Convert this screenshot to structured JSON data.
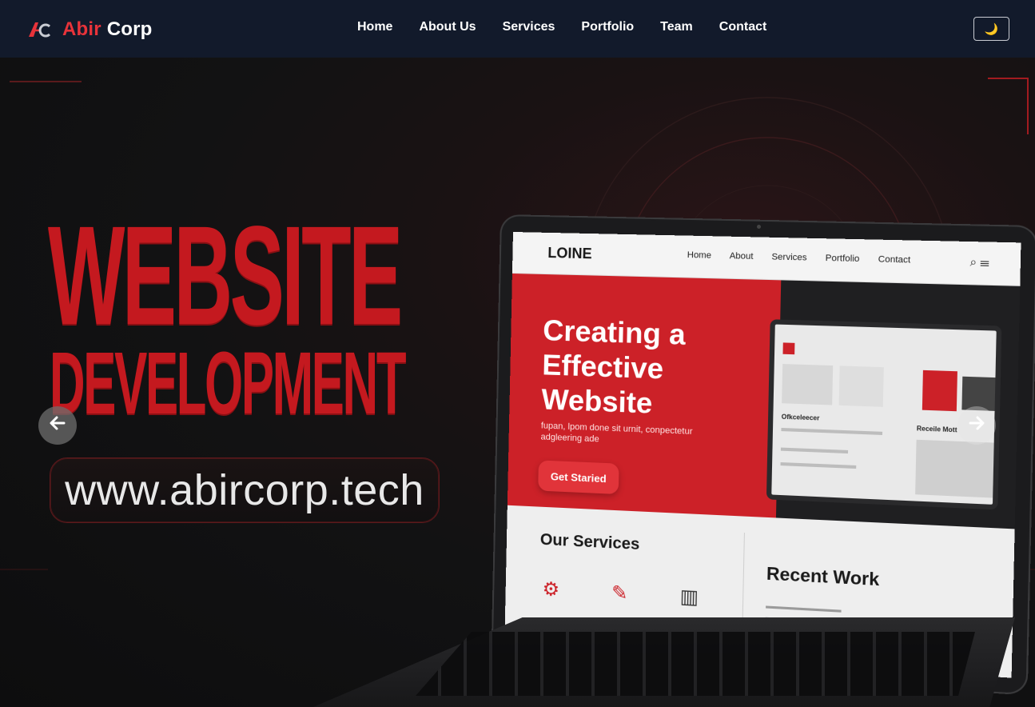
{
  "brand": {
    "logo_icon": "ac-logo-icon",
    "name_accent": "Abir",
    "name_rest": "Corp",
    "accent_color": "#e8333a"
  },
  "nav": {
    "links": [
      {
        "label": "Home"
      },
      {
        "label": "About Us"
      },
      {
        "label": "Services"
      },
      {
        "label": "Portfolio"
      },
      {
        "label": "Team"
      },
      {
        "label": "Contact"
      }
    ],
    "theme_toggle_icon": "moon-icon",
    "theme_toggle_glyph": "🌙"
  },
  "hero": {
    "headline_line1": "WEBSITE",
    "headline_line2": "DEVELOPMENT",
    "url": "www.abircorp.tech",
    "prev_icon": "arrow-left-icon",
    "next_icon": "arrow-right-icon",
    "headline_color": "#c4191f"
  },
  "laptop_screen": {
    "logo": "LOINE",
    "links": [
      "Home",
      "About",
      "Services",
      "Portfolio",
      "Contact"
    ],
    "title": "Creating a Effective Website",
    "title_line1": "Creating a",
    "title_line2": "Effective",
    "title_line3": "Website",
    "subtitle": "fupan, lpom done sit urnit, conpectetur adgleering ade",
    "cta": "Get Staried",
    "services_heading": "Our Services",
    "recent_heading": "Recent Work",
    "mini_heading_left": "Ofkceleecer",
    "mini_heading_right": "Receile Mott"
  }
}
